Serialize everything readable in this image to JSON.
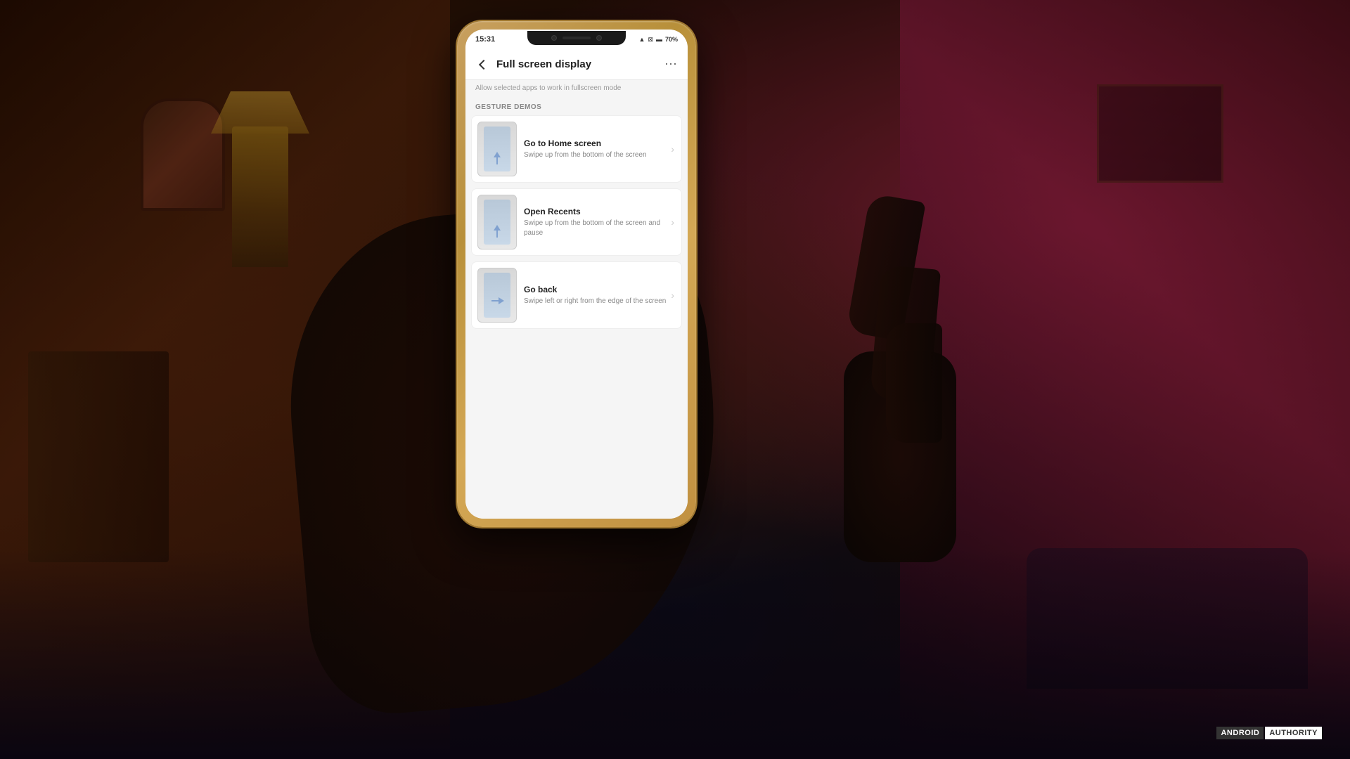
{
  "background": {
    "color": "#1a0a05"
  },
  "phone": {
    "status_bar": {
      "time": "15:31",
      "wifi_icon": "wifi",
      "signal_icon": "signal",
      "battery_percent": "70%"
    },
    "header": {
      "title": "Full screen display",
      "back_label": "back",
      "more_label": "more"
    },
    "subtitle": "Allow selected apps to work in fullscreen mode",
    "section_label": "GESTURE DEMOS",
    "gesture_items": [
      {
        "title": "Go to Home screen",
        "description": "Swipe up from the bottom of the screen",
        "thumb_type": "swipe-up"
      },
      {
        "title": "Open Recents",
        "description": "Swipe up from the bottom of the screen and pause",
        "thumb_type": "swipe-up-pause"
      },
      {
        "title": "Go back",
        "description": "Swipe left or right from the edge of the screen",
        "thumb_type": "swipe-side"
      }
    ]
  },
  "watermark": {
    "android_text": "ANDROID",
    "authority_text": "AUTHORITY"
  }
}
